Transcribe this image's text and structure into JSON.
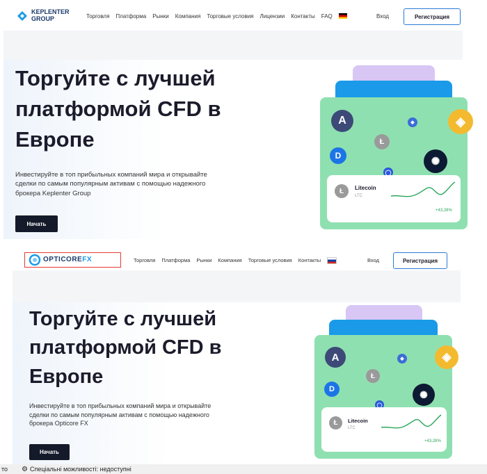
{
  "top": {
    "logo_line1": "KEPLENTER",
    "logo_line2": "GROUP",
    "nav": [
      "Торговля",
      "Платформа",
      "Рынки",
      "Компания",
      "Торговые условия",
      "Лицензии",
      "Контакты",
      "FAQ"
    ],
    "login": "Вход",
    "register": "Регистрация",
    "hero_title_1": "Торгуйте с лучшей",
    "hero_title_2": "платформой CFD в",
    "hero_title_3": "Европе",
    "hero_sub_1": "Инвестируйте в топ прибыльных компаний мира и открывайте",
    "hero_sub_2": "сделки по самым популярным активам с помощью надежного",
    "hero_sub_3": "брокера Keplenter Group",
    "cta": "Начать",
    "coin_name": "Litecoin",
    "coin_ticker": "LTC",
    "coin_pct": "+43,28%"
  },
  "bottom": {
    "logo_a": "OPTICORE",
    "logo_b": "FX",
    "nav": [
      "Торговля",
      "Платформа",
      "Рынки",
      "Компания",
      "Торговые условия",
      "Контакты"
    ],
    "login": "Вход",
    "register": "Регистрация",
    "hero_title_1": "Торгуйте с лучшей",
    "hero_title_2": "платформой CFD в",
    "hero_title_3": "Европе",
    "hero_sub_1": "Инвестируйте в топ прибыльных компаний мира и открывайте",
    "hero_sub_2": "сделки по самым популярным активам с помощью надежного",
    "hero_sub_3": "брокера Opticore FX",
    "cta": "Начать",
    "coin_name": "Litecoin",
    "coin_ticker": "LTC",
    "coin_pct": "+43,28%"
  },
  "statusbar": {
    "left": "то",
    "accessibility": "Спеціальні можливості: недоступні"
  },
  "colors": {
    "accent_blue": "#1a9ae8",
    "card_green": "#8fe0b1",
    "tab_purple": "#d8c6f5",
    "dark_button": "#151a2a",
    "highlight_red": "#e53935",
    "chart_green": "#2aa65a"
  },
  "icons": [
    "keplenter-logo-icon",
    "opticore-logo-icon",
    "german-flag-icon",
    "russian-flag-icon",
    "avalanche-icon",
    "ethereum-icon",
    "binance-icon",
    "litecoin-icon",
    "dash-icon",
    "cardano-icon",
    "chainlink-icon",
    "accessibility-icon"
  ]
}
